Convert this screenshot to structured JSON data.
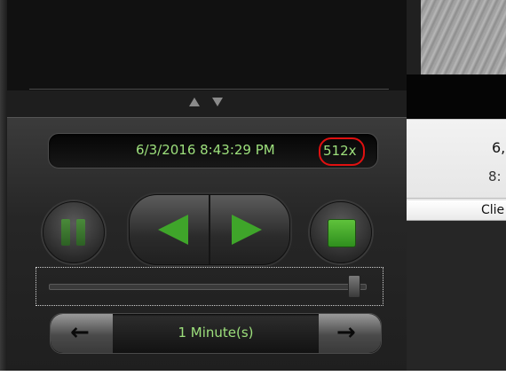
{
  "player": {
    "timestamp": "6/3/2016 8:43:29 PM",
    "speed": "512x",
    "interval_label": "1 Minute(s)",
    "interval_prev_icon": "←",
    "interval_next_icon": "→",
    "slider_fraction": 0.96
  },
  "side_panel": {
    "date_fragment": "6,",
    "time_fragment": "8:",
    "column_header": "Clie"
  },
  "icons": {
    "collapse_up": "collapse-up-icon",
    "collapse_down": "collapse-down-icon",
    "pause": "pause-icon",
    "stop": "stop-icon",
    "rewind": "rewind-icon",
    "play": "play-icon"
  },
  "colors": {
    "display_text": "#9de07c",
    "accent_green": "#3fa52a",
    "highlight_ring": "#e01010",
    "panel_bg": "#1e1e1e"
  }
}
